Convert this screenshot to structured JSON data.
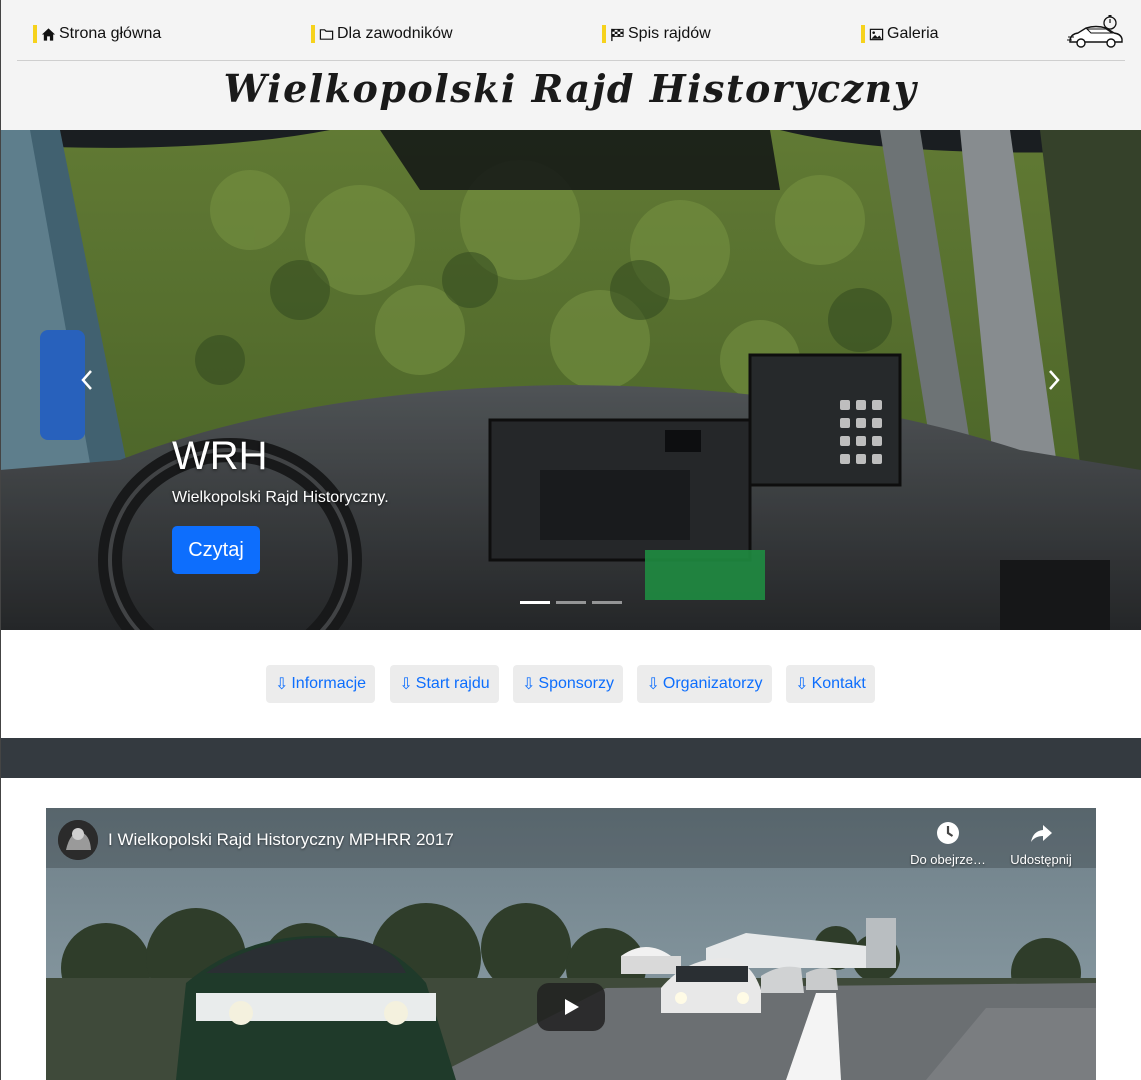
{
  "nav": {
    "items": [
      {
        "label": "Strona główna",
        "icon": "home-icon"
      },
      {
        "label": "Dla zawodników",
        "icon": "folder-icon"
      },
      {
        "label": "Spis rajdów",
        "icon": "checkered-flag-icon"
      },
      {
        "label": "Galeria",
        "icon": "image-icon"
      }
    ],
    "accent_color": "#f6d21c",
    "logo_icon": "rally-car-logo-icon"
  },
  "site": {
    "title": "Wielkopolski Rajd Historyczny"
  },
  "carousel": {
    "caption_title": "WRH",
    "caption_text": "Wielkopolski Rajd Historyczny.",
    "button_label": "Czytaj",
    "slides_total": 3,
    "active_slide": 1,
    "prev_icon": "chevron-left-icon",
    "next_icon": "chevron-right-icon"
  },
  "sections": {
    "arrow_icon": "down-arrow-icon",
    "buttons": [
      {
        "label": "Informacje"
      },
      {
        "label": "Start rajdu"
      },
      {
        "label": "Sponsorzy"
      },
      {
        "label": "Organizatorzy"
      },
      {
        "label": "Kontakt"
      }
    ]
  },
  "video": {
    "title": "I Wielkopolski Rajd Historyczny MPHRR 2017",
    "watch_later_label": "Do obejrze…",
    "share_label": "Udostępnij"
  },
  "colors": {
    "primary": "#0d6efd",
    "dark_band": "#343a40",
    "header_bg": "#f4f4f4"
  }
}
